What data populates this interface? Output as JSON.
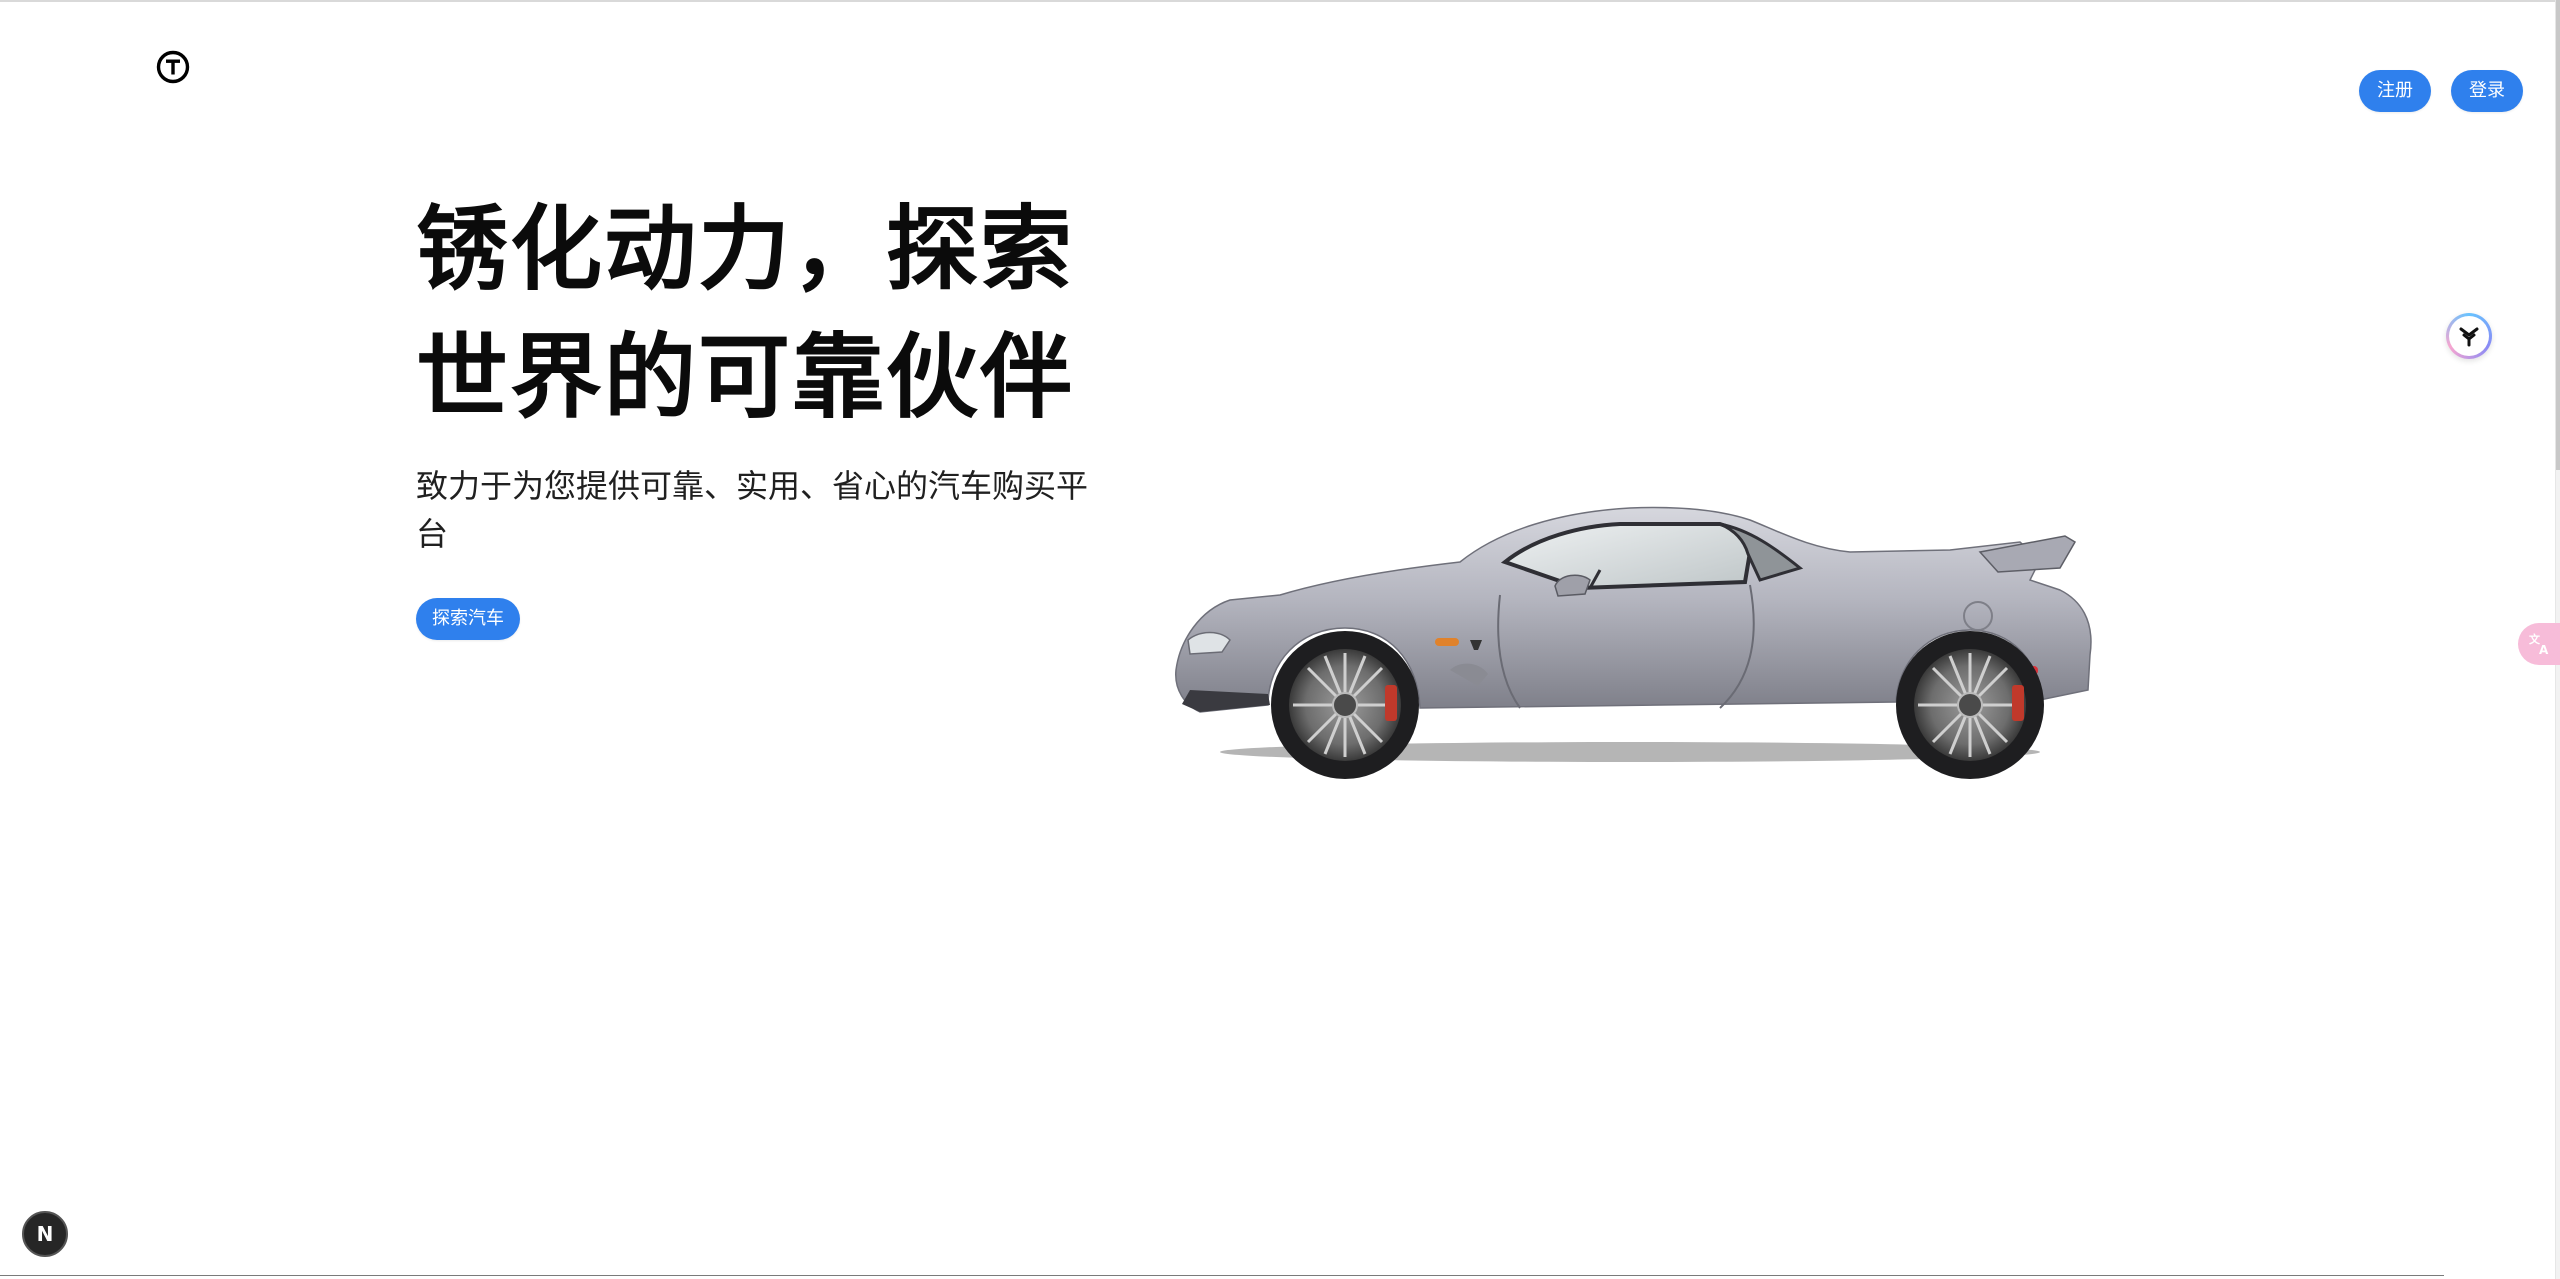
{
  "header": {
    "logo_icon": "circled-t-logo-icon",
    "register_label": "注册",
    "login_label": "登录"
  },
  "hero": {
    "title_line1": "锈化动力，探索",
    "title_line2": "世界的可靠伙伴",
    "subtitle": "致力于为您提供可靠、实用、省心的汽车购买平台",
    "cta_label": "探索汽车"
  },
  "image": {
    "name": "silver-sports-car-image"
  },
  "floating": {
    "assistant_icon": "assistant-icon",
    "translate_icon": "translate-icon",
    "next_badge": "N"
  },
  "colors": {
    "accent": "#2f80ed",
    "title": "#0b0b0b",
    "translate_tab": "#f7bcd9"
  }
}
